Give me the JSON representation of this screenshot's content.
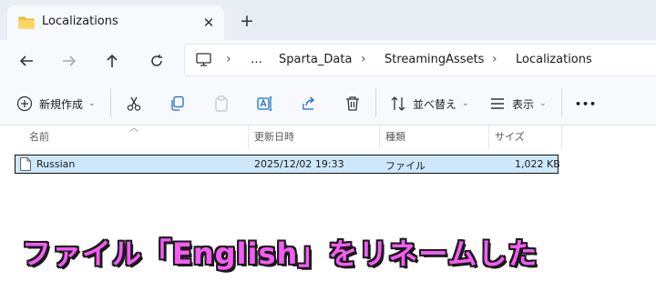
{
  "tab": {
    "title": "Localizations",
    "close_glyph": "✕",
    "new_tab_glyph": "+"
  },
  "nav": {
    "icons": [
      "back-icon",
      "forward-icon",
      "up-icon",
      "refresh-icon",
      "computer-icon"
    ],
    "breadcrumb": [
      "…",
      "Sparta_Data",
      "StreamingAssets",
      "Localizations"
    ],
    "separator": "›"
  },
  "commands": {
    "new_label": "新規作成",
    "sort_label": "並べ替え",
    "view_label": "表示",
    "more_glyph": "•••",
    "icons": [
      "plus-icon",
      "cut-icon",
      "copy-icon",
      "paste-icon",
      "rename-icon",
      "share-icon",
      "delete-icon",
      "sort-icon",
      "view-icon"
    ]
  },
  "columns": {
    "name": "名前",
    "modified": "更新日時",
    "type": "種類",
    "size": "サイズ"
  },
  "files": [
    {
      "name": "Russian",
      "modified": "2025/12/02 19:33",
      "type": "ファイル",
      "size": "1,022 KB"
    }
  ],
  "caption": "ファイル「English」をリネームした",
  "colors": {
    "caption": "#f45cf4",
    "selection": "#cde8fb",
    "folder": "#f4c542"
  }
}
